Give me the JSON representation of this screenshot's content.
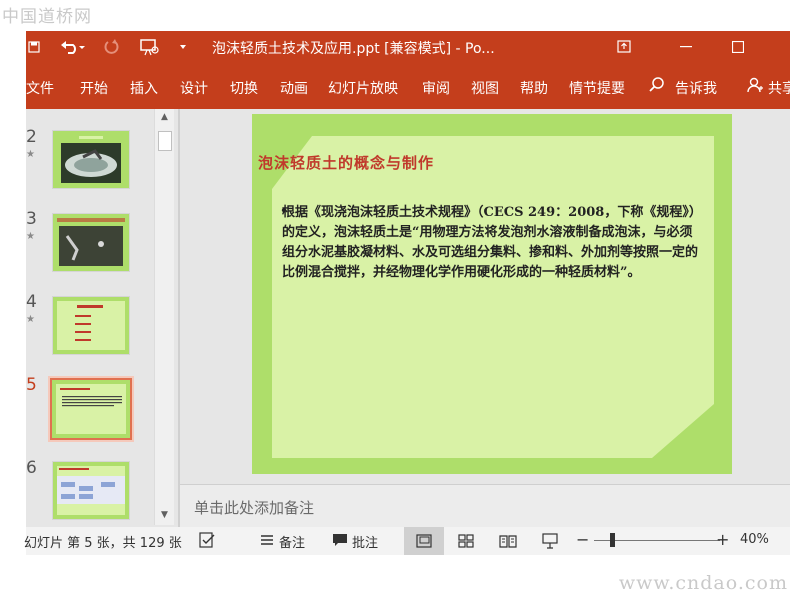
{
  "watermark": {
    "top": "中国道桥网",
    "bottom": "www.cndao.com"
  },
  "titlebar": {
    "doc_title": "泡沫轻质土技术及应用.ppt [兼容模式] - Po..."
  },
  "ribbon": {
    "tabs": [
      "文件",
      "开始",
      "插入",
      "设计",
      "切换",
      "动画",
      "幻灯片放映",
      "审阅",
      "视图",
      "帮助",
      "情节提要"
    ],
    "tell_me": "告诉我",
    "share": "共享"
  },
  "thumbnails": [
    {
      "number": "2",
      "active": false
    },
    {
      "number": "3",
      "active": false
    },
    {
      "number": "4",
      "active": false
    },
    {
      "number": "5",
      "active": true
    },
    {
      "number": "6",
      "active": false
    }
  ],
  "slide": {
    "title": "泡沫轻质土的概念与制作",
    "body": "根据《现浇泡沫轻质土技术规程》（CECS 249：2008，下称《规程》）的定义，泡沫轻质土是“用物理方法将发泡剂水溶液制备成泡沫，与必须组分水泥基胶凝材料、水及可选组分集料、掺和料、外加剂等按照一定的比例混合搅拌，并经物理化学作用硬化形成的一种轻质材料”。"
  },
  "notes": {
    "placeholder": "单击此处添加备注"
  },
  "status": {
    "slide_info": "幻灯片 第 5 张，共 129 张",
    "notes_label": "备注",
    "comments_label": "批注",
    "zoom": "40%"
  },
  "colors": {
    "accent": "#c43e1c",
    "slide_outer": "#aede6a",
    "slide_inner": "#d9f2a6",
    "title": "#c0392b"
  }
}
